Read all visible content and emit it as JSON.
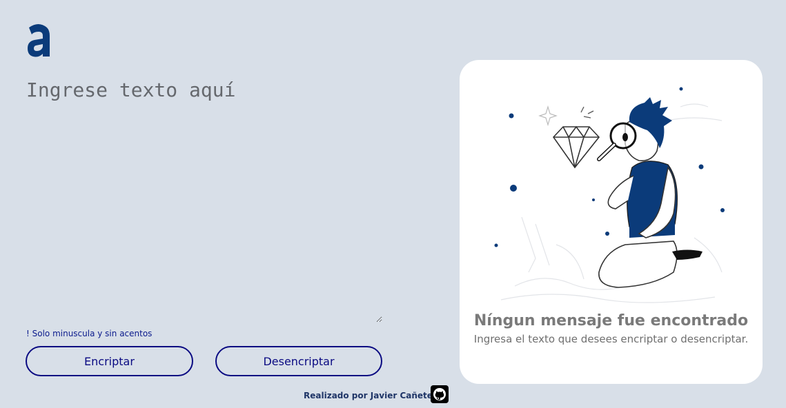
{
  "logo": {
    "letter": "a",
    "color": "#0b3b7a"
  },
  "input": {
    "placeholder": "Ingrese texto aquí"
  },
  "warning_text": "! Solo minuscula y sin acentos",
  "buttons": {
    "encrypt": "Encriptar",
    "decrypt": "Desencriptar"
  },
  "output_panel": {
    "title": "Níngun mensaje fue encontrado",
    "subtitle": "Ingresa el texto que desees encriptar o desencriptar."
  },
  "footer": {
    "credit": "Realizado por Javier Cañete",
    "icon": "github-icon"
  },
  "colors": {
    "background": "#d8dfe8",
    "accent": "#0a0a82",
    "brand": "#0b3b7a",
    "panel": "#ffffff"
  }
}
